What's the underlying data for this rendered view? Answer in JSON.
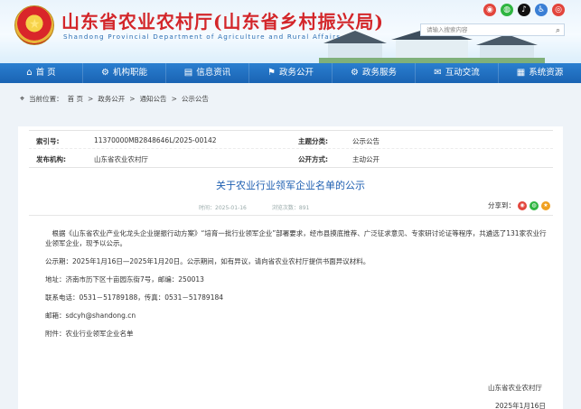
{
  "header": {
    "title": "山东省农业农村厅(山东省乡村振兴局)",
    "subtitle": "Shandong Provincial Department of Agriculture and Rural Affairs",
    "search_placeholder": "请输入搜索内容",
    "social_icons": [
      "weibo-icon",
      "wechat-icon",
      "douyin-icon",
      "accessibility-icon",
      "elder-mode-icon"
    ]
  },
  "nav": {
    "items": [
      {
        "label": "首 页",
        "icon": "home-icon"
      },
      {
        "label": "机构职能",
        "icon": "org-icon"
      },
      {
        "label": "信息资讯",
        "icon": "info-icon"
      },
      {
        "label": "政务公开",
        "icon": "flag-icon"
      },
      {
        "label": "政务服务",
        "icon": "service-icon"
      },
      {
        "label": "互动交流",
        "icon": "chat-icon"
      },
      {
        "label": "系统资源",
        "icon": "resource-icon"
      }
    ]
  },
  "breadcrumb": {
    "prefix": "当前位置：",
    "items": [
      "首 页",
      "政务公开",
      "通知公告",
      "公示公告"
    ],
    "separator": ">"
  },
  "meta": {
    "index_label": "索引号:",
    "index_value": "11370000MB2848646L/2025-00142",
    "topic_label": "主题分类:",
    "topic_value": "公示公告",
    "publisher_label": "发布机构:",
    "publisher_value": "山东省农业农村厅",
    "mode_label": "公开方式:",
    "mode_value": "主动公开"
  },
  "article": {
    "title": "关于农业行业领军企业名单的公示",
    "date": "时间：2025-01-16",
    "views": "浏览次数：891",
    "share_label": "分享到：",
    "paragraphs": [
      "根据《山东省农业产业化龙头企业提振行动方案》“培育一批行业领军企业”部署要求，经市县摸底推荐、广泛征求意见、专家研讨论证等程序，共遴选了131家农业行业领军企业，现予以公示。",
      "公示期：2025年1月16日—2025年1月20日。公示期间，如有异议，请向省农业农村厅提供书面异议材料。",
      "地址：济南市历下区十亩园东街7号，邮编：250013",
      "联系电话：0531－51789188，传真：0531－51789184",
      "邮箱：sdcyh@shandong.cn",
      "附件：农业行业领军企业名单"
    ],
    "signature": "山东省农业农村厅",
    "sign_date": "2025年1月16日"
  },
  "colors": {
    "title_red": "#d3262a",
    "nav_blue": "#1f6fc2",
    "link_blue": "#1e5fb1"
  }
}
